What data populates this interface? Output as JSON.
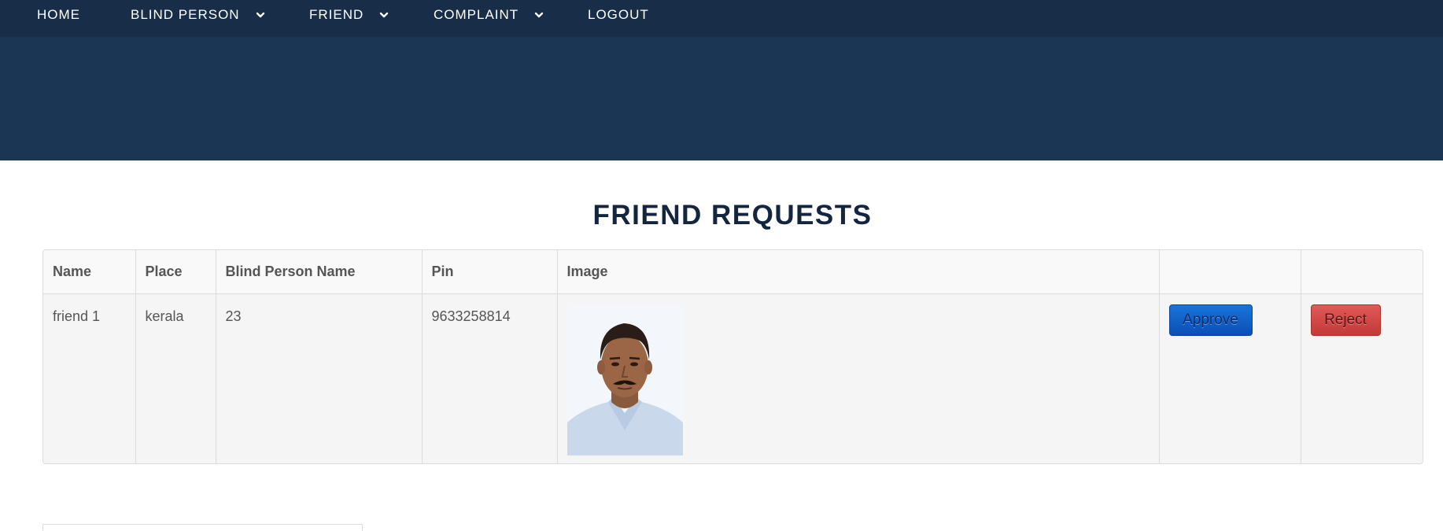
{
  "nav": {
    "items": [
      {
        "label": "HOME",
        "dropdown": false
      },
      {
        "label": "BLIND PERSON",
        "dropdown": true
      },
      {
        "label": "FRIEND",
        "dropdown": true
      },
      {
        "label": "COMPLAINT",
        "dropdown": true
      },
      {
        "label": "LOGOUT",
        "dropdown": false
      }
    ]
  },
  "page": {
    "title": "FRIEND REQUESTS"
  },
  "table": {
    "headers": [
      "Name",
      "Place",
      "Blind Person Name",
      "Pin",
      "Image",
      "",
      ""
    ],
    "rows": [
      {
        "name": "friend 1",
        "place": "kerala",
        "blind_person_name": "23",
        "pin": "9633258814",
        "approve_label": "Approve",
        "reject_label": "Reject"
      }
    ]
  },
  "colors": {
    "nav_bg": "#182e48",
    "hero_bg": "#1b3655",
    "title": "#14263f",
    "approve": "#1a74d8",
    "reject": "#d64b49"
  }
}
